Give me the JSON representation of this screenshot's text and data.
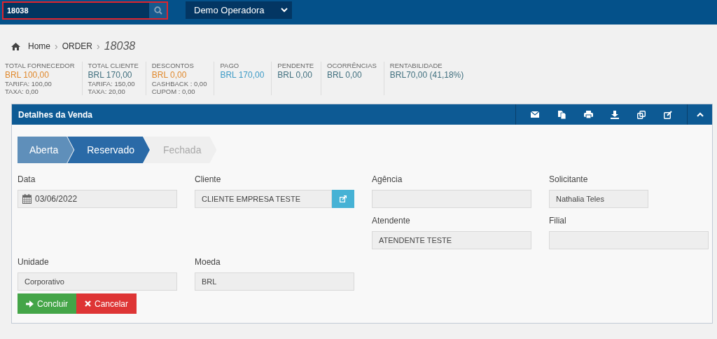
{
  "topbar": {
    "search": {
      "value": "18038"
    },
    "operator_select": {
      "value": "Demo Operadora"
    }
  },
  "breadcrumb": {
    "items": [
      "Home",
      "ORDER"
    ],
    "current": "18038",
    "separator": "›"
  },
  "stats": [
    {
      "label": "TOTAL FORNECEDOR",
      "value": "BRL 100,00",
      "color": "#e0892d",
      "details": [
        "TARIFA: 100,00",
        "TAXA: 0,00"
      ]
    },
    {
      "label": "TOTAL CLIENTE",
      "value": "BRL 170,00",
      "color": "#41707f",
      "details": [
        "TARIFA: 150,00",
        "TAXA: 20,00"
      ]
    },
    {
      "label": "DESCONTOS",
      "value": "BRL 0,00",
      "color": "#e0892d",
      "details": [
        "CASHBACK : 0,00",
        "CUPOM : 0,00"
      ]
    },
    {
      "label": "PAGO",
      "value": "BRL 170,00",
      "color": "#3d9bc6"
    },
    {
      "label": "PENDENTE",
      "value": "BRL 0,00",
      "color": "#41707f"
    },
    {
      "label": "OCORRÊNCIAS",
      "value": "BRL 0,00",
      "color": "#41707f"
    },
    {
      "label": "RENTABILIDADE",
      "value": "BRL70,00 (41,18%)",
      "color": "#41707f"
    }
  ],
  "panel": {
    "title": "Detalhes da Venda",
    "expanded": true,
    "steps": [
      {
        "label": "Aberta",
        "kind": "done"
      },
      {
        "label": "Reservado",
        "kind": "current"
      },
      {
        "label": "Fechada",
        "kind": "pending"
      }
    ],
    "rows": [
      [
        {
          "label": "Data",
          "value": "03/06/2022",
          "kind": "date"
        },
        {
          "label": "Cliente",
          "value": "CLIENTE EMPRESA TESTE",
          "kind": "link"
        },
        {
          "label": "Agência",
          "kind": "text"
        },
        {
          "label": "Solicitante",
          "value": "Nathalia Teles",
          "kind": "short"
        }
      ],
      [
        null,
        null,
        {
          "label": "Atendente",
          "value": "ATENDENTE TESTE",
          "kind": "text"
        },
        {
          "label": "Filial",
          "kind": "text"
        }
      ],
      [
        {
          "label": "Unidade",
          "value": "Corporativo",
          "kind": "text"
        },
        {
          "label": "Moeda",
          "value": "BRL",
          "kind": "text"
        },
        null,
        null
      ]
    ],
    "buttons": [
      {
        "label": "Concluir",
        "kind": "confirm"
      },
      {
        "label": "Cancelar",
        "kind": "cancel"
      }
    ]
  }
}
